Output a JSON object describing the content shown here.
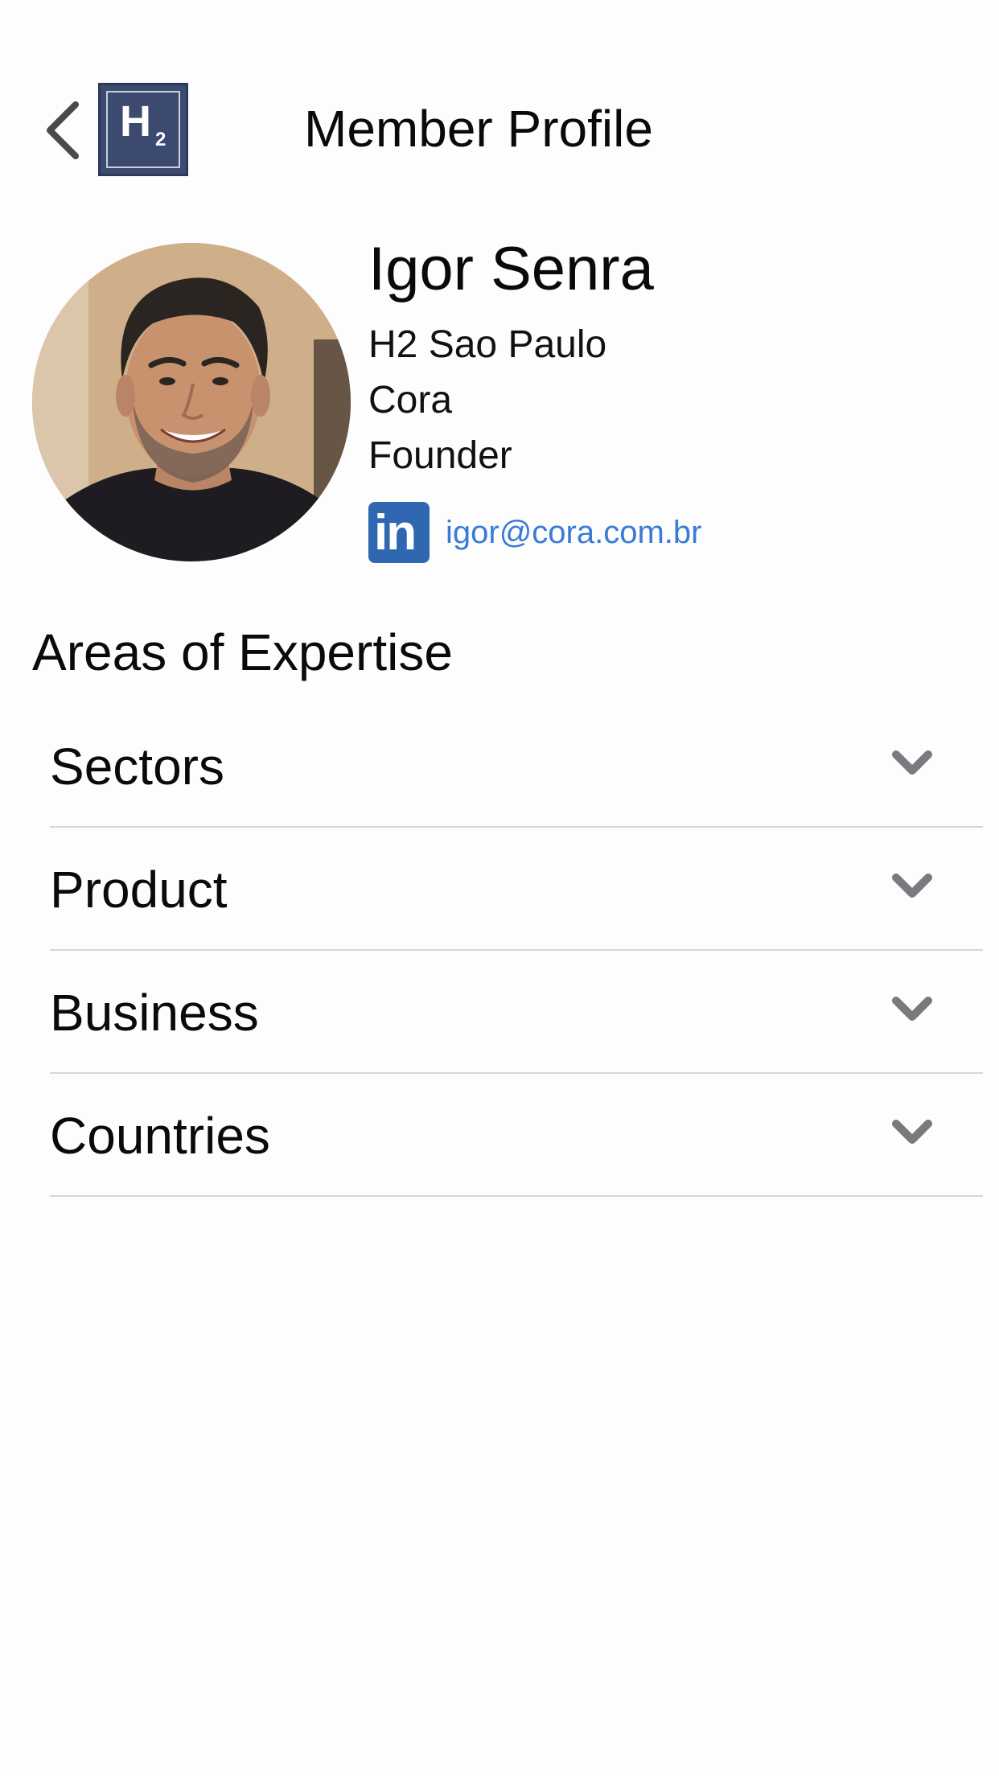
{
  "header": {
    "title": "Member Profile",
    "logo_main": "H",
    "logo_subscript": "2"
  },
  "profile": {
    "name": "Igor Senra",
    "chapter": "H2 Sao Paulo",
    "company": "Cora",
    "role": "Founder",
    "linkedin_icon_text": "in",
    "email": "igor@cora.com.br"
  },
  "expertise": {
    "title": "Areas of Expertise",
    "items": [
      {
        "label": "Sectors"
      },
      {
        "label": "Product"
      },
      {
        "label": "Business"
      },
      {
        "label": "Countries"
      }
    ]
  },
  "colors": {
    "logo_background": "#3c4a70",
    "linkedin": "#2f67b0",
    "link": "#3a7bd5",
    "chevron": "#7a7a7e",
    "divider": "#d6d6d8"
  },
  "icons": {
    "back": "chevron-left-icon",
    "accordion": "chevron-down-icon"
  }
}
